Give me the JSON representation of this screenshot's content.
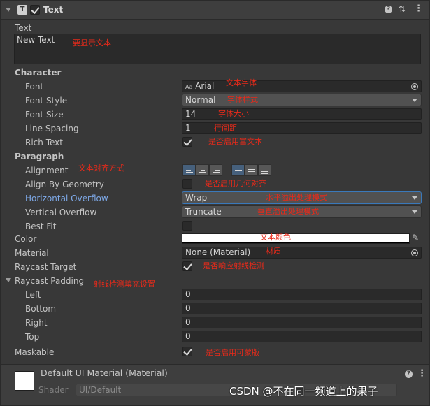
{
  "header": {
    "title": "Text",
    "type_icon": "T",
    "enabled": true,
    "icons": [
      "help-icon",
      "preset-icon",
      "menu-icon"
    ]
  },
  "text_field": {
    "label": "Text",
    "value": "New Text"
  },
  "character": {
    "section_label": "Character",
    "font_label": "Font",
    "font_value": "Arial",
    "font_badge": "Aa",
    "font_style_label": "Font Style",
    "font_style_value": "Normal",
    "font_size_label": "Font Size",
    "font_size_value": "14",
    "line_spacing_label": "Line Spacing",
    "line_spacing_value": "1",
    "rich_text_label": "Rich Text",
    "rich_text_checked": true
  },
  "paragraph": {
    "section_label": "Paragraph",
    "alignment_label": "Alignment",
    "align_geometry_label": "Align By Geometry",
    "align_geometry_checked": false,
    "horizontal_overflow_label": "Horizontal Overflow",
    "horizontal_overflow_value": "Wrap",
    "vertical_overflow_label": "Vertical Overflow",
    "vertical_overflow_value": "Truncate",
    "best_fit_label": "Best Fit",
    "best_fit_checked": false
  },
  "color": {
    "label": "Color",
    "value": "#ffffff"
  },
  "material": {
    "label": "Material",
    "value": "None (Material)"
  },
  "raycast_target": {
    "label": "Raycast Target",
    "checked": true
  },
  "raycast_padding": {
    "label": "Raycast Padding",
    "left_label": "Left",
    "left_value": "0",
    "bottom_label": "Bottom",
    "bottom_value": "0",
    "right_label": "Right",
    "right_value": "0",
    "top_label": "Top",
    "top_value": "0"
  },
  "maskable": {
    "label": "Maskable",
    "checked": true
  },
  "footer": {
    "material_name": "Default UI Material (Material)",
    "shader_label": "Shader",
    "shader_value": "UI/Default"
  },
  "annotations": {
    "text": "要显示文本",
    "font": "文本字体",
    "font_style": "字体样式",
    "font_size": "字体大小",
    "line_spacing": "行间距",
    "rich_text": "是否启用富文本",
    "alignment": "文本对齐方式",
    "align_geometry": "是否启用几何对齐",
    "horizontal_overflow": "水平溢出处理模式",
    "vertical_overflow": "垂直溢出处理模式",
    "color": "文本颜色",
    "material": "材质",
    "raycast_target": "是否响应射线检测",
    "raycast_padding": "射线检测填充设置",
    "maskable": "是否启用可蒙版"
  },
  "watermark": "CSDN @不在同一频道上的果子",
  "colors": {
    "annotation": "#e82a1a",
    "accent_blue": "#7ea9e8",
    "panel": "#383838"
  }
}
